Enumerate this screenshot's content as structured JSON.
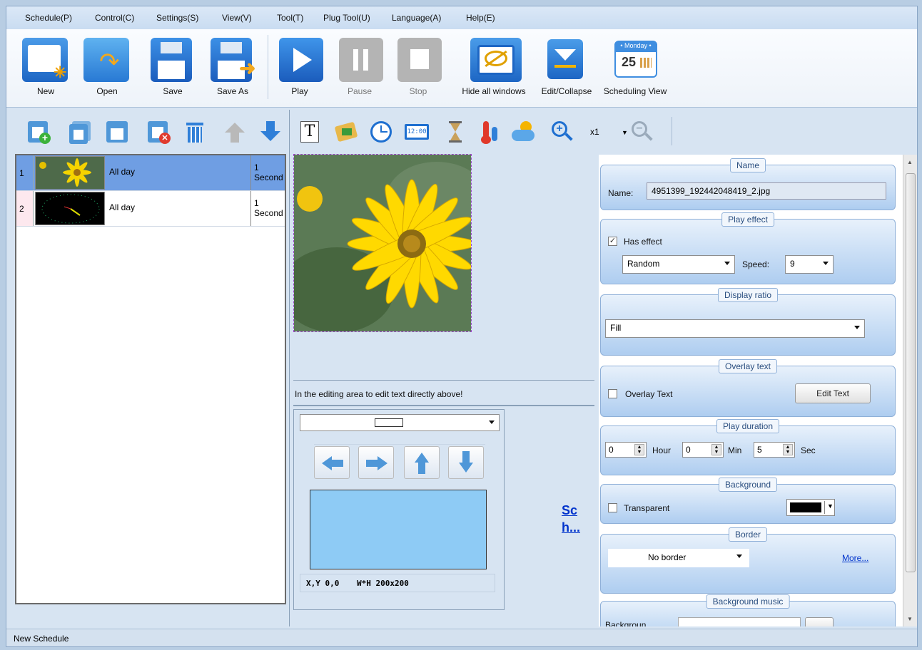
{
  "menu": [
    "Schedule(P)",
    "Control(C)",
    "Settings(S)",
    "View(V)",
    "Tool(T)",
    "Plug Tool(U)",
    "Language(A)",
    "Help(E)"
  ],
  "toolbar": {
    "new": "New",
    "open": "Open",
    "save": "Save",
    "save_as": "Save As",
    "play": "Play",
    "pause": "Pause",
    "stop": "Stop",
    "hide_all": "Hide all windows",
    "edit_collapse": "Edit/Collapse",
    "scheduling_view": "Scheduling View",
    "calendar_day": "• Monday •",
    "calendar_date": "25"
  },
  "schedule_list": [
    {
      "num": "1",
      "when": "All day",
      "duration": "1 Second",
      "selected": true
    },
    {
      "num": "2",
      "when": "All day",
      "duration": "1 Second",
      "selected": false
    }
  ],
  "zoom": "x1",
  "clock_text": "12:00",
  "editor": {
    "hint": "In the editing area to edit text directly above!",
    "coords": "X,Y 0,0",
    "size": "W*H 200x200",
    "link": "Sch..."
  },
  "props": {
    "name_group": "Name",
    "name_label": "Name:",
    "name_value": "4951399_192442048419_2.jpg",
    "play_effect_group": "Play effect",
    "has_effect": "Has effect",
    "effect_value": "Random",
    "speed_label": "Speed:",
    "speed_value": "9",
    "display_ratio_group": "Display ratio",
    "ratio_value": "Fill",
    "overlay_group": "Overlay text",
    "overlay_label": "Overlay Text",
    "edit_text_btn": "Edit Text",
    "duration_group": "Play duration",
    "hour_value": "0",
    "hour_label": "Hour",
    "min_value": "0",
    "min_label": "Min",
    "sec_value": "5",
    "sec_label": "Sec",
    "background_group": "Background",
    "transparent_label": "Transparent",
    "border_group": "Border",
    "border_value": "No border",
    "more_link": "More...",
    "music_group": "Background music",
    "music_label": "Backgroun"
  },
  "status": "New Schedule",
  "colors": {
    "accent": "#1e6fd0",
    "selected_row": "#6f9ee3",
    "group_title": "#2b4f80"
  }
}
